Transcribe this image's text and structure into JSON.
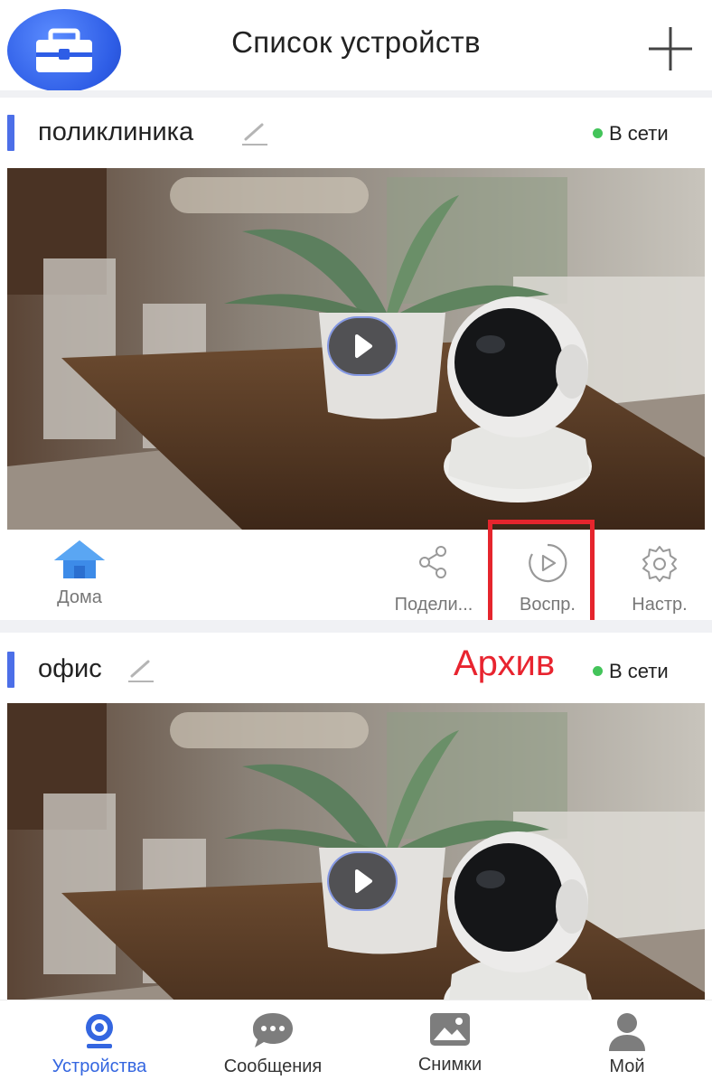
{
  "header": {
    "title": "Список устройств"
  },
  "devices": [
    {
      "name": "поликлиника",
      "status": "В сети",
      "actions": {
        "home": "Дома",
        "share": "Подели...",
        "playback": "Воспр.",
        "settings": "Настр."
      }
    },
    {
      "name": "офис",
      "status": "В сети",
      "annotation": "Архив"
    }
  ],
  "bottom_nav": {
    "devices": "Устройства",
    "messages": "Сообщения",
    "snapshots": "Снимки",
    "mine": "Мой"
  },
  "colors": {
    "accent": "#4c6fe8",
    "online": "#43c45a",
    "highlight": "#e5252d",
    "nav_active": "#3466e0"
  }
}
